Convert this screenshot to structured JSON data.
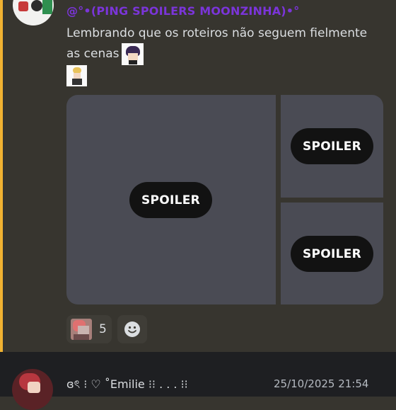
{
  "message": {
    "author": "@°•(PING SPOILERS MOONZINHA)•°",
    "author_color": "#7b35d9",
    "text_line1": "Lembrando que os roteiros não seguem fielmente",
    "text_line2": "as cenas",
    "inline_emoji": "custom-character-emoji",
    "extra_emoji": "custom-character-emoji",
    "attachments": [
      {
        "label": "SPOILER"
      },
      {
        "label": "SPOILER"
      },
      {
        "label": "SPOILER"
      }
    ],
    "reactions": [
      {
        "emoji": "custom-character-emoji",
        "count": "5"
      }
    ],
    "add_reaction_icon": "smile-icon"
  },
  "next_message": {
    "author": "ɞৎ ⁝ ♡ ˚Emilie ⁝⁝ . . . ⁝⁝",
    "timestamp": "25/10/2025 21:54"
  },
  "colors": {
    "highlight_bar": "#f0b232",
    "background": "#37352f",
    "spoiler_tile": "#4a4b54",
    "spoiler_pill": "#121212"
  }
}
